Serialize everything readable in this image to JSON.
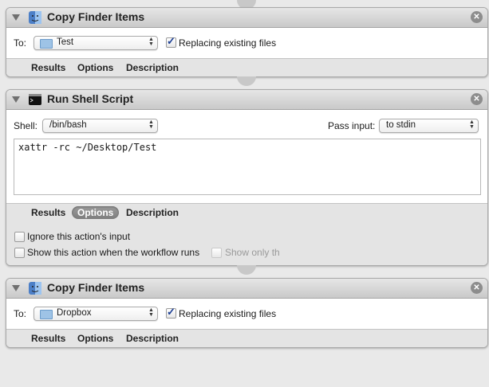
{
  "actions": [
    {
      "title": "Copy Finder Items",
      "icon": "finder-icon",
      "to_label": "To:",
      "to_value": "Test",
      "replacing_label": "Replacing existing files",
      "replacing_checked": true,
      "tabs": [
        "Results",
        "Options",
        "Description"
      ]
    },
    {
      "title": "Run Shell Script",
      "icon": "terminal-icon",
      "shell_label": "Shell:",
      "shell_value": "/bin/bash",
      "pass_input_label": "Pass input:",
      "pass_input_value": "to stdin",
      "script": "xattr -rc ~/Desktop/Test",
      "tabs": [
        "Results",
        "Options",
        "Description"
      ],
      "active_tab": "Options",
      "options": {
        "ignore_input_label": "Ignore this action's input",
        "show_when_runs_label": "Show this action when the workflow runs",
        "show_only_label": "Show only th"
      }
    },
    {
      "title": "Copy Finder Items",
      "icon": "finder-icon",
      "to_label": "To:",
      "to_value": "Dropbox",
      "replacing_label": "Replacing existing files",
      "replacing_checked": true,
      "tabs": [
        "Results",
        "Options",
        "Description"
      ]
    }
  ],
  "colors": {
    "background": "#e9e9e9",
    "header": "#d4d4d4",
    "checkbox_check": "#1c3f94"
  }
}
